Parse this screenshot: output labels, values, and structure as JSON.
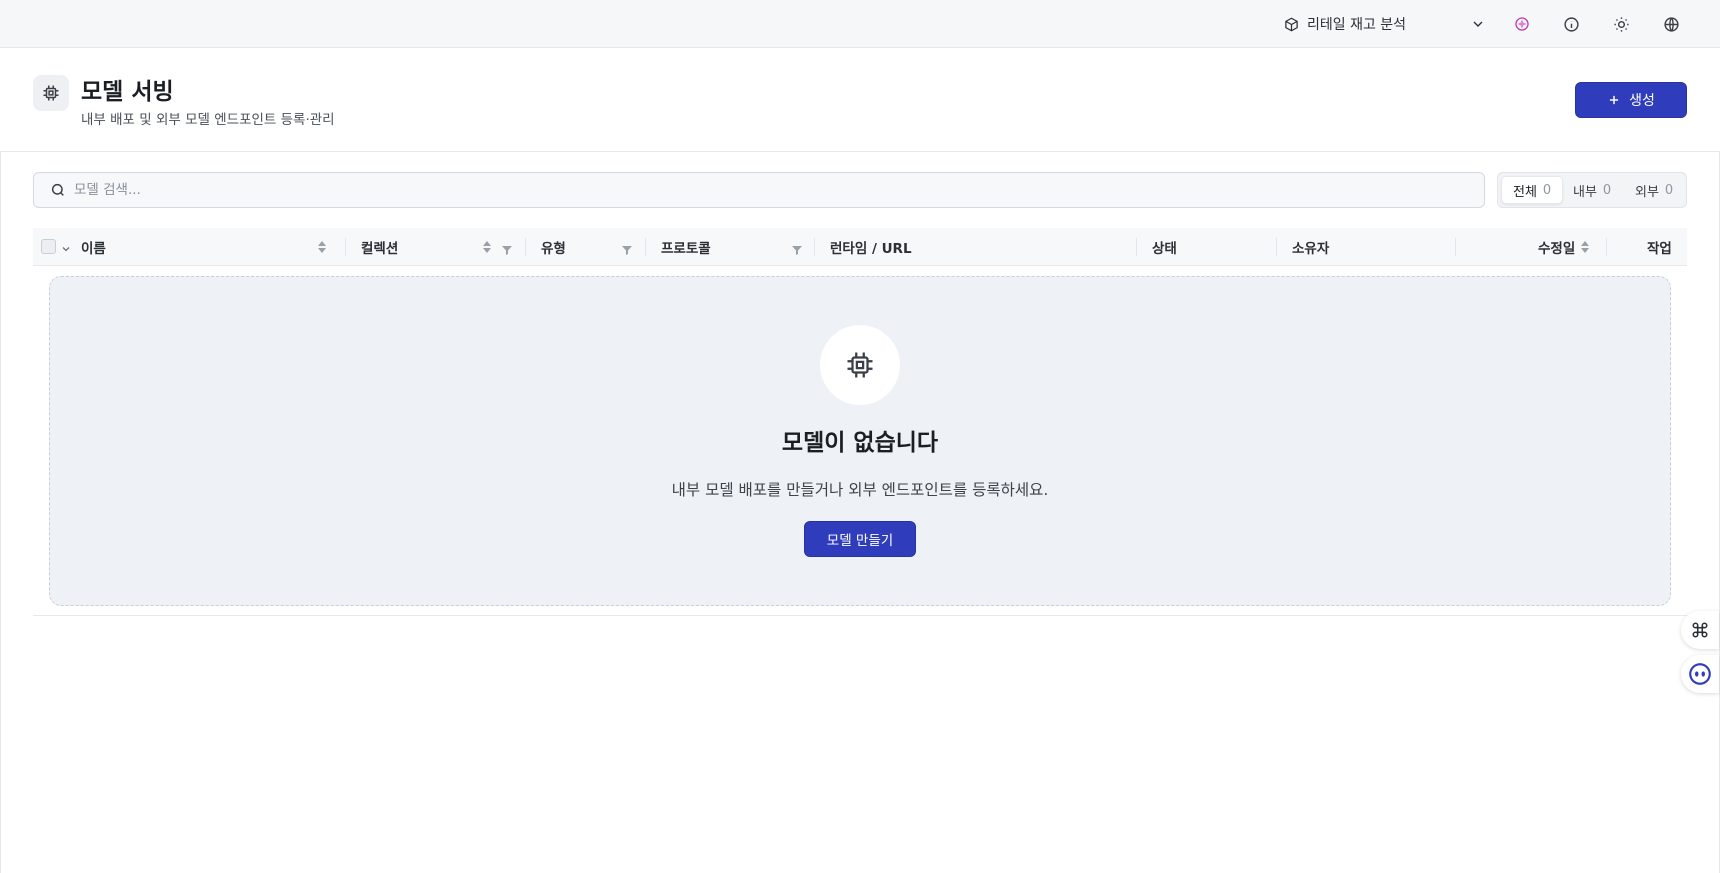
{
  "topbar": {
    "project_name": "리테일 재고 분석",
    "icons": [
      "cube-icon",
      "chevron-down-icon",
      "ai-sparkle-icon",
      "info-icon",
      "theme-sun-icon",
      "globe-icon"
    ]
  },
  "header": {
    "title": "모델 서빙",
    "subtitle": "내부 배포 및 외부 모델 엔드포인트 등록·관리",
    "create_label": "생성"
  },
  "search": {
    "placeholder": "모델 검색..."
  },
  "filters": [
    {
      "label": "전체",
      "count": "0",
      "active": true
    },
    {
      "label": "내부",
      "count": "0",
      "active": false
    },
    {
      "label": "외부",
      "count": "0",
      "active": false
    }
  ],
  "table": {
    "columns": {
      "name": "이름",
      "collection": "컬렉션",
      "type": "유형",
      "protocol": "프로토콜",
      "runtime": "런타임 / URL",
      "status": "상태",
      "owner": "소유자",
      "modified": "수정일",
      "actions": "작업"
    }
  },
  "empty_state": {
    "title": "모델이 없습니다",
    "description": "내부 모델 배포를 만들거나 외부 엔드포인트를 등록하세요.",
    "button_label": "모델 만들기"
  },
  "colors": {
    "primary": "#2f3dbd",
    "topbar_bg": "#f6f7f9",
    "empty_bg": "#eef1f6",
    "ai_icon": "#c13ab7"
  }
}
